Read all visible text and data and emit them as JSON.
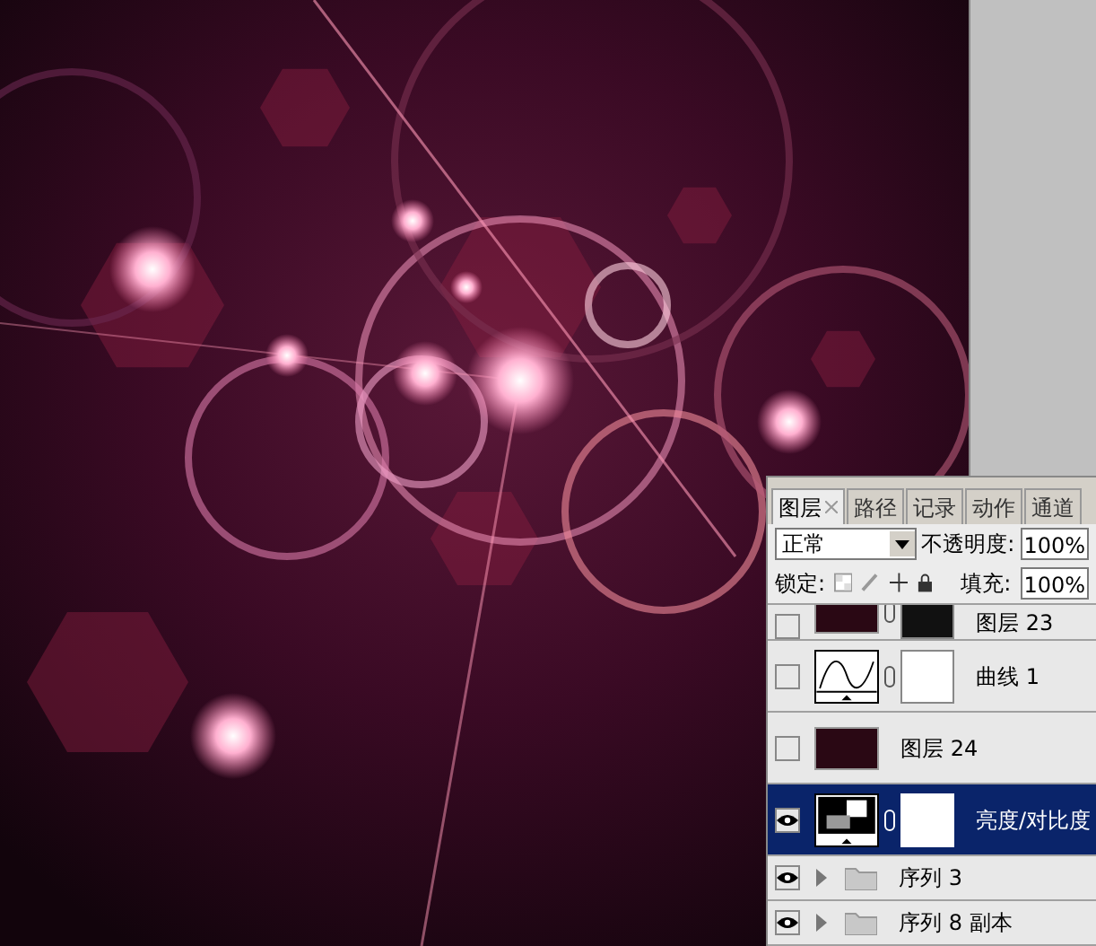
{
  "layers_panel": {
    "tabs": [
      {
        "label": "图层",
        "selected": true,
        "closable": true
      },
      {
        "label": "路径",
        "selected": false,
        "closable": false
      },
      {
        "label": "记录",
        "selected": false,
        "closable": false
      },
      {
        "label": "动作",
        "selected": false,
        "closable": false
      },
      {
        "label": "通道",
        "selected": false,
        "closable": false
      }
    ],
    "blend_mode": "正常",
    "opacity_label": "不透明度:",
    "opacity_value": "100%",
    "lock_label": "锁定:",
    "fill_label": "填充:",
    "fill_value": "100%",
    "layers": [
      {
        "name": "图层 23",
        "kind": "pixel",
        "has_mask": true,
        "visible": false,
        "selected": false
      },
      {
        "name": "曲线 1",
        "kind": "curves",
        "has_mask": true,
        "visible": false,
        "selected": false
      },
      {
        "name": "图层 24",
        "kind": "pixel",
        "has_mask": false,
        "visible": false,
        "selected": false
      },
      {
        "name": "亮度/对比度",
        "kind": "brightness",
        "has_mask": true,
        "visible": true,
        "selected": true
      },
      {
        "name": "序列 3",
        "kind": "group",
        "visible": true,
        "selected": false
      },
      {
        "name": "序列 8 副本",
        "kind": "group",
        "visible": true,
        "selected": false
      }
    ]
  }
}
